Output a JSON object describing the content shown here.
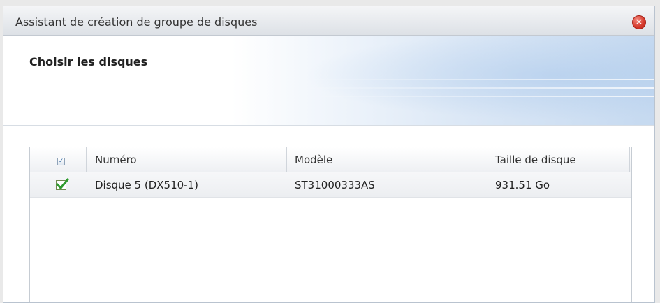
{
  "window": {
    "title": "Assistant de création de groupe de disques",
    "close_icon": "close-circle-icon"
  },
  "step": {
    "title": "Choisir les disques"
  },
  "table": {
    "columns": [
      "Numéro",
      "Modèle",
      "Taille de disque"
    ],
    "select_all_checked": true,
    "rows": [
      {
        "checked": true,
        "number": "Disque 5 (DX510-1)",
        "model": "ST31000333AS",
        "size": "931.51 Go"
      }
    ]
  },
  "colors": {
    "check_green": "#2e9b2e",
    "close_red": "#d4382b"
  }
}
